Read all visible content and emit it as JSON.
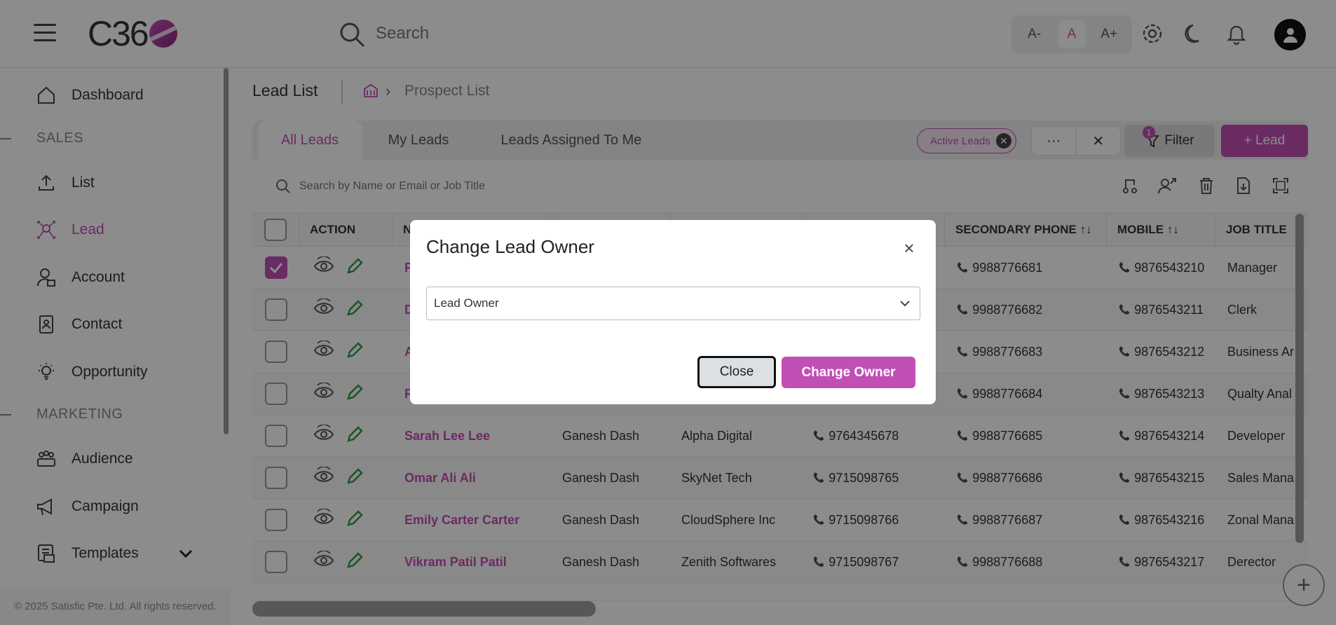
{
  "header": {
    "logo_text": "C36",
    "search_placeholder": "Search",
    "font_small": "A-",
    "font_normal": "A",
    "font_large": "A+"
  },
  "sidebar": {
    "items": [
      {
        "label": "Dashboard"
      },
      {
        "label": "List"
      },
      {
        "label": "Lead"
      },
      {
        "label": "Account"
      },
      {
        "label": "Contact"
      },
      {
        "label": "Opportunity"
      },
      {
        "label": "Audience"
      },
      {
        "label": "Campaign"
      },
      {
        "label": "Templates"
      }
    ],
    "sections": [
      "SALES",
      "MARKETING"
    ],
    "footer": "© 2025 Satisfic Pte. Ltd. All rights reserved."
  },
  "page": {
    "title": "Lead List",
    "breadcrumb": "Prospect List"
  },
  "tabs": [
    "All Leads",
    "My Leads",
    "Leads Assigned To Me"
  ],
  "filters": {
    "chip": "Active Leads",
    "more": "···",
    "clear": "✕",
    "filter_label": "Filter",
    "filter_count": "1",
    "add_lead": "+ Lead"
  },
  "table_search_placeholder": "Search by Name or Email or Job Title",
  "table": {
    "headers": [
      "ACTION",
      "N",
      "",
      "",
      "",
      "SECONDARY PHONE ↑↓",
      "MOBILE ↑↓",
      "JOB TITLE"
    ],
    "rows": [
      {
        "name": "F",
        "owner": "",
        "company": "",
        "phone": "",
        "secondary": "9988776681",
        "mobile": "9876543210",
        "job": "Manager"
      },
      {
        "name": "D",
        "owner": "",
        "company": "",
        "phone": "",
        "secondary": "9988776682",
        "mobile": "9876543211",
        "job": "Clerk"
      },
      {
        "name": "A",
        "owner": "",
        "company": "",
        "phone": "",
        "secondary": "9988776683",
        "mobile": "9876543212",
        "job": "Business Ar"
      },
      {
        "name": "F",
        "owner": "",
        "company": "",
        "phone": "",
        "secondary": "9988776684",
        "mobile": "9876543213",
        "job": "Qualty Anal"
      },
      {
        "name": "Sarah Lee Lee",
        "owner": "Ganesh Dash",
        "company": "Alpha Digital",
        "phone": "9764345678",
        "secondary": "9988776685",
        "mobile": "9876543214",
        "job": "Developer"
      },
      {
        "name": "Omar Ali Ali",
        "owner": "Ganesh Dash",
        "company": "SkyNet Tech",
        "phone": "9715098765",
        "secondary": "9988776686",
        "mobile": "9876543215",
        "job": "Sales Mana"
      },
      {
        "name": "Emily Carter Carter",
        "owner": "Ganesh Dash",
        "company": "CloudSphere Inc",
        "phone": "9715098766",
        "secondary": "9988776687",
        "mobile": "9876543216",
        "job": "Zonal Mana"
      },
      {
        "name": "Vikram Patil Patil",
        "owner": "Ganesh Dash",
        "company": "Zenith Softwares",
        "phone": "9715098767",
        "secondary": "9988776688",
        "mobile": "9876543217",
        "job": "Derector"
      }
    ]
  },
  "modal": {
    "title": "Change Lead Owner",
    "select_value": "Lead Owner",
    "close_label": "Close",
    "submit_label": "Change Owner"
  },
  "colors": {
    "accent": "#c24fb5",
    "overlay": "rgba(0,0,0,0.45)"
  }
}
